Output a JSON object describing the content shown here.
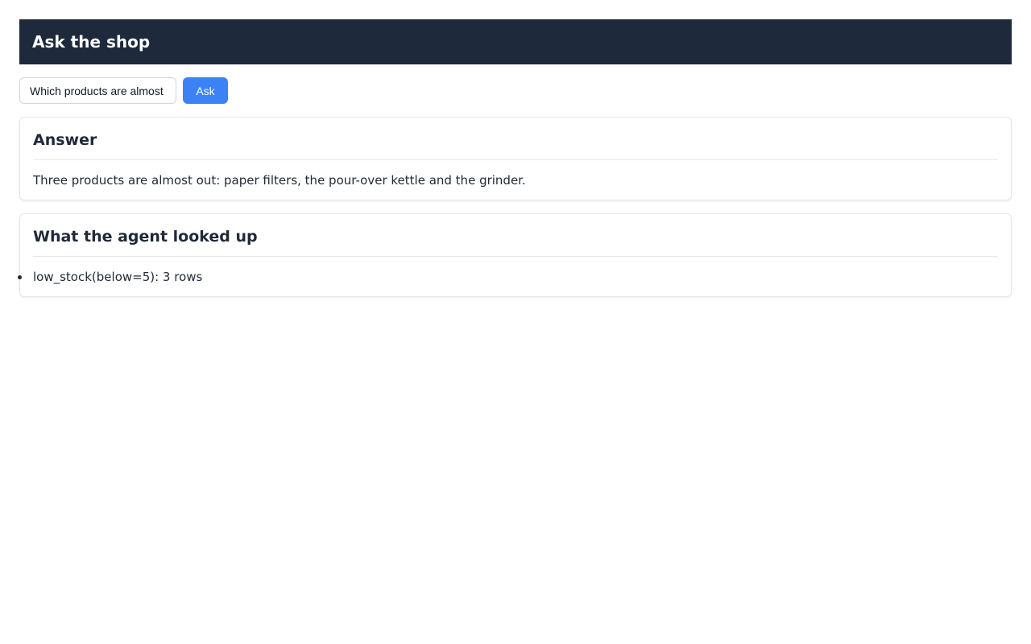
{
  "header": {
    "title": "Ask the shop"
  },
  "ask": {
    "input_value": "Which products are almost out of stock?",
    "button_label": "Ask"
  },
  "answer": {
    "heading": "Answer",
    "text": "Three products are almost out: paper filters, the pour-over kettle and the grinder."
  },
  "lookups": {
    "heading": "What the agent looked up",
    "items": [
      {
        "label": "low_stock(below=5): 3 rows"
      }
    ]
  },
  "colors": {
    "header_bg": "#1e293b",
    "accent": "#3b82f6"
  }
}
